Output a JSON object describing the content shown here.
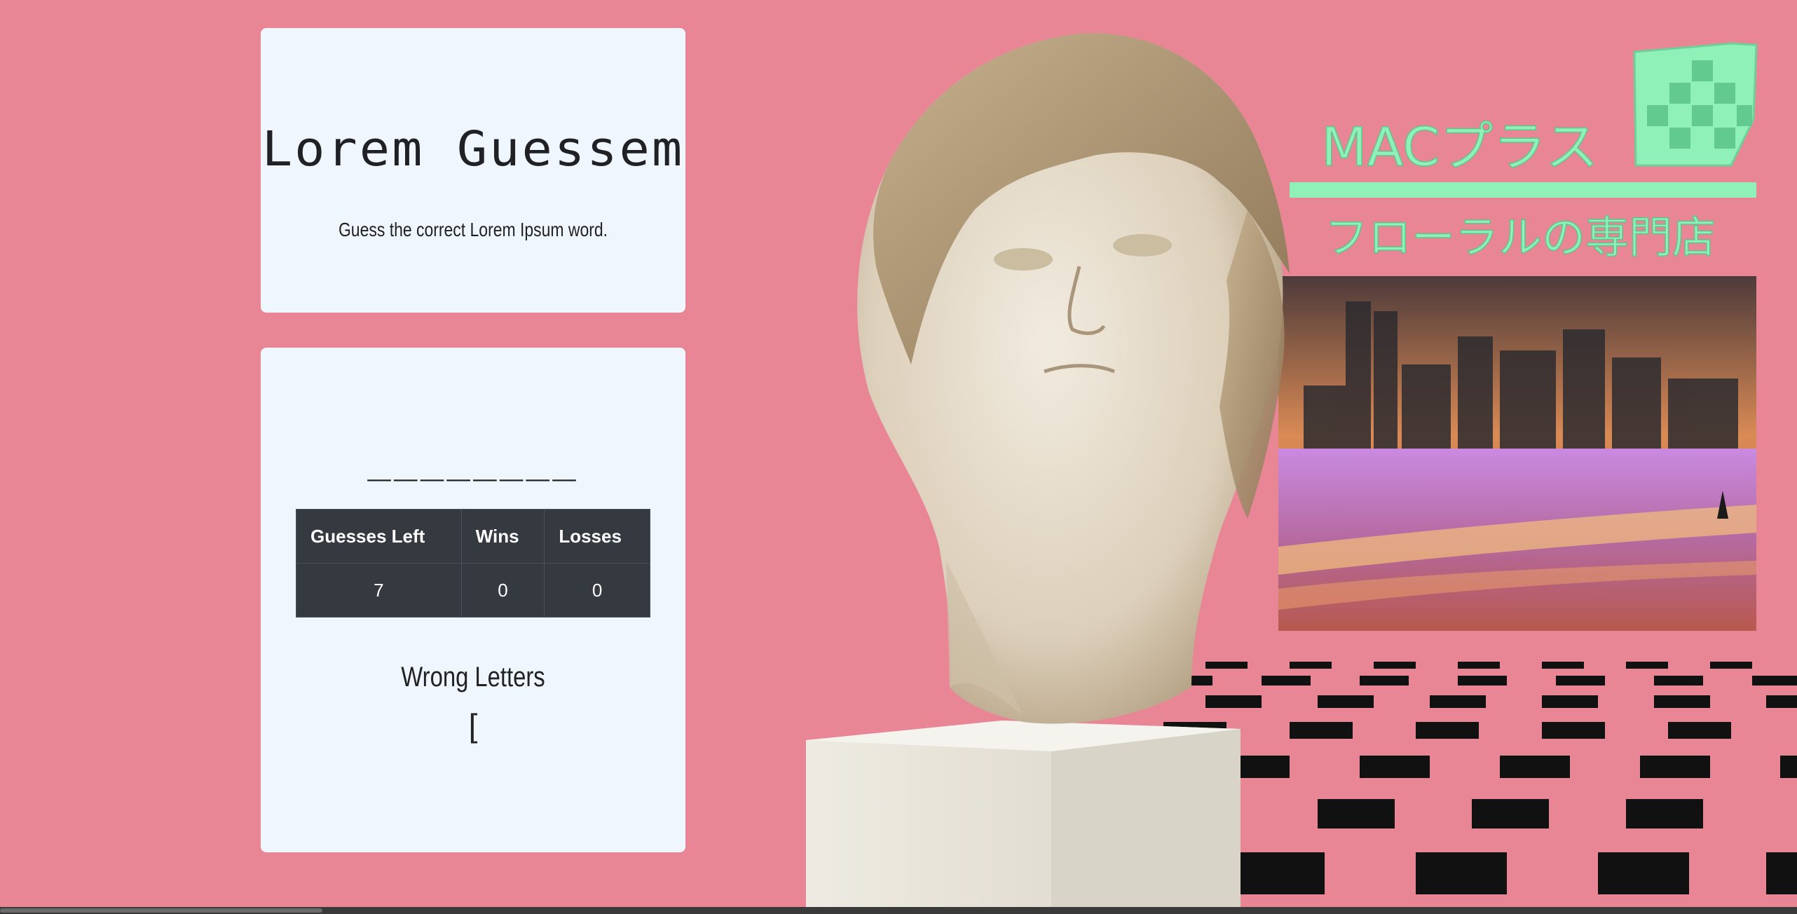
{
  "header": {
    "title": "Lorem Guessem",
    "subtitle": "Guess the correct Lorem Ipsum word."
  },
  "game": {
    "word_display": "________",
    "stats": {
      "headers": [
        "Guesses Left",
        "Wins",
        "Losses"
      ],
      "values": [
        "7",
        "0",
        "0"
      ]
    },
    "wrong_letters_label": "Wrong Letters",
    "wrong_letters_value": "["
  },
  "artwork": {
    "brand_line1": "MACプラス",
    "brand_line2": "フローラルの専門店",
    "colors": {
      "background": "#e98696",
      "brand_green": "#8ff0b8",
      "card": "#f0f6fd",
      "table": "#343a40"
    }
  }
}
